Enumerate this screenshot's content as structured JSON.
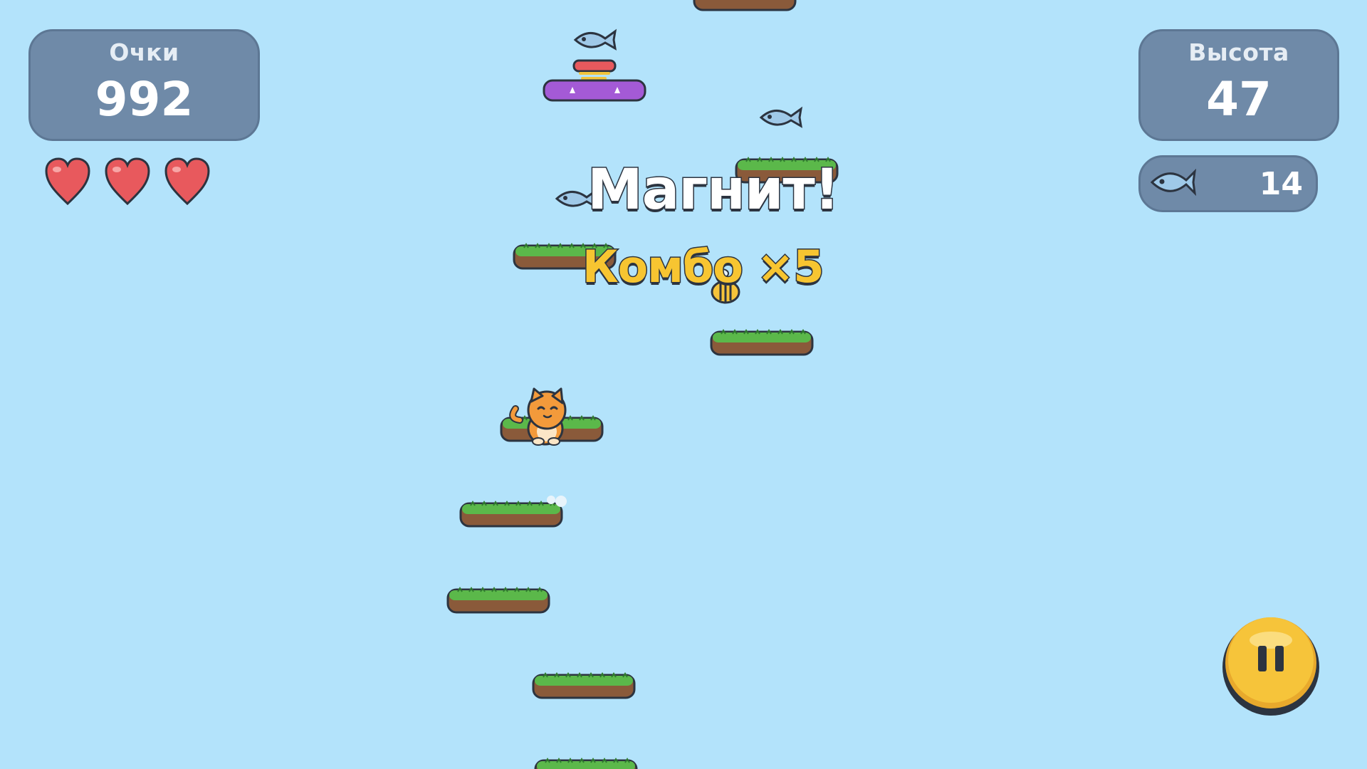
{
  "hud": {
    "score": {
      "label": "Очки",
      "value": "992"
    },
    "height": {
      "label": "Высота",
      "value": "47"
    },
    "fish": {
      "count": "14",
      "icon": "fish-icon"
    },
    "lives": {
      "count": 3,
      "max": 3,
      "icon": "heart-icon"
    },
    "pause": {
      "icon": "pause-icon"
    }
  },
  "popups": {
    "powerup": "Магнит!",
    "combo": "Комбо ×5"
  },
  "colors": {
    "sky": "#b3e3fb",
    "panel": "#6f8aa8",
    "grass": "#5bb84a",
    "dirt": "#8a5a3a",
    "spring_platform": "#a45ad6",
    "heart": "#e8595d",
    "pause_button": "#f6c43a",
    "combo_text": "#f7c531"
  },
  "entities": {
    "player": "cat",
    "enemies": [
      "bee"
    ],
    "pickups": [
      "fish",
      "fish",
      "fish"
    ],
    "platforms": [
      "grass",
      "grass",
      "grass",
      "grass",
      "grass",
      "grass",
      "grass",
      "grass",
      "spring",
      "dirt"
    ]
  }
}
